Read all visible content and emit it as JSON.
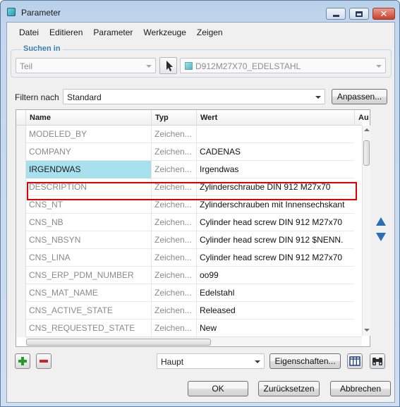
{
  "window": {
    "title": "Parameter"
  },
  "menu": [
    "Datei",
    "Editieren",
    "Parameter",
    "Werkzeuge",
    "Zeigen"
  ],
  "search": {
    "legend": "Suchen in",
    "scope_value": "Teil",
    "part_value": "D912M27X70_EDELSTAHL"
  },
  "filter": {
    "label": "Filtern nach",
    "value": "Standard",
    "customize_label": "Anpassen..."
  },
  "table": {
    "columns": [
      "Name",
      "Typ",
      "Wert",
      "Au"
    ],
    "rows": [
      {
        "name": "MODELED_BY",
        "type": "Zeichen...",
        "value": ""
      },
      {
        "name": "COMPANY",
        "type": "Zeichen...",
        "value": "CADENAS"
      },
      {
        "name": "IRGENDWAS",
        "type": "Zeichen...",
        "value": "Irgendwas"
      },
      {
        "name": "DESCRIPTION",
        "type": "Zeichen...",
        "value": "Zylinderschraube DIN 912 M27x70"
      },
      {
        "name": "CNS_NT",
        "type": "Zeichen...",
        "value": "Zylinderschrauben mit Innensechskant"
      },
      {
        "name": "CNS_NB",
        "type": "Zeichen...",
        "value": "Cylinder head screw DIN 912 M27x70"
      },
      {
        "name": "CNS_NBSYN",
        "type": "Zeichen...",
        "value": "Cylinder head screw DIN 912 $NENN."
      },
      {
        "name": "CNS_LINA",
        "type": "Zeichen...",
        "value": "Cylinder head screw DIN 912 M27x70"
      },
      {
        "name": "CNS_ERP_PDM_NUMBER",
        "type": "Zeichen...",
        "value": "oo99"
      },
      {
        "name": "CNS_MAT_NAME",
        "type": "Zeichen...",
        "value": "Edelstahl"
      },
      {
        "name": "CNS_ACTIVE_STATE",
        "type": "Zeichen...",
        "value": "Released"
      },
      {
        "name": "CNS_REQUESTED_STATE",
        "type": "Zeichen...",
        "value": "New"
      }
    ],
    "selected_row": 2
  },
  "bottom": {
    "view_value": "Haupt",
    "properties_label": "Eigenschaften..."
  },
  "footer": {
    "ok_label": "OK",
    "reset_label": "Zurücksetzen",
    "cancel_label": "Abbrechen"
  },
  "colors": {
    "selection": "#a8e1ed",
    "highlight_border": "#e00000",
    "legend_text": "#3c7fb1",
    "nav_arrow": "#2a6fb5",
    "add_green": "#2a9b2a",
    "remove_red": "#c0282b"
  },
  "icons": {
    "app": "parameter-app-icon",
    "cursor": "pointer-cursor-icon",
    "part": "part-icon",
    "add": "plus-icon",
    "remove": "minus-icon",
    "columns": "columns-grid-icon",
    "find": "binoculars-icon",
    "up": "triangle-up-icon",
    "down": "triangle-down-icon"
  }
}
